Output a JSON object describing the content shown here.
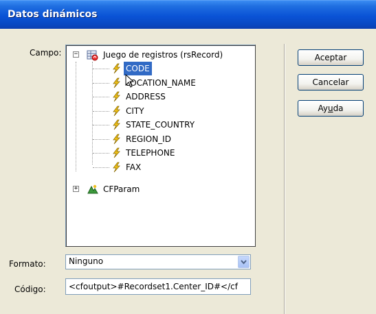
{
  "window": {
    "title": "Datos dinámicos"
  },
  "labels": {
    "campo": "Campo:",
    "formato": "Formato:",
    "codigo": "Código:"
  },
  "tree": {
    "root": {
      "label": "Juego de registros (rsRecord)",
      "expanded": true,
      "icon": "recordset-icon"
    },
    "fields": [
      {
        "label": "CODE",
        "selected": true,
        "icon": "bolt-icon"
      },
      {
        "label": "LOCATION_NAME",
        "selected": false,
        "icon": "bolt-icon"
      },
      {
        "label": "ADDRESS",
        "selected": false,
        "icon": "bolt-icon"
      },
      {
        "label": "CITY",
        "selected": false,
        "icon": "bolt-icon"
      },
      {
        "label": "STATE_COUNTRY",
        "selected": false,
        "icon": "bolt-icon"
      },
      {
        "label": "REGION_ID",
        "selected": false,
        "icon": "bolt-icon"
      },
      {
        "label": "TELEPHONE",
        "selected": false,
        "icon": "bolt-icon"
      },
      {
        "label": "FAX",
        "selected": false,
        "icon": "bolt-icon"
      }
    ],
    "second_root": {
      "label": "CFParam",
      "expanded": false,
      "icon": "cfparam-icon"
    }
  },
  "buttons": {
    "accept": "Aceptar",
    "cancel": "Cancelar",
    "help_prefix": "Ay",
    "help_underlined": "u",
    "help_suffix": "da"
  },
  "formato": {
    "selected": "Ninguno"
  },
  "codigo": {
    "value": "<cfoutput>#Recordset1.Center_ID#</cf"
  },
  "colors": {
    "selection": "#316ac5",
    "titlebar": "#0a53d6",
    "dialog_bg": "#ece9d8"
  }
}
